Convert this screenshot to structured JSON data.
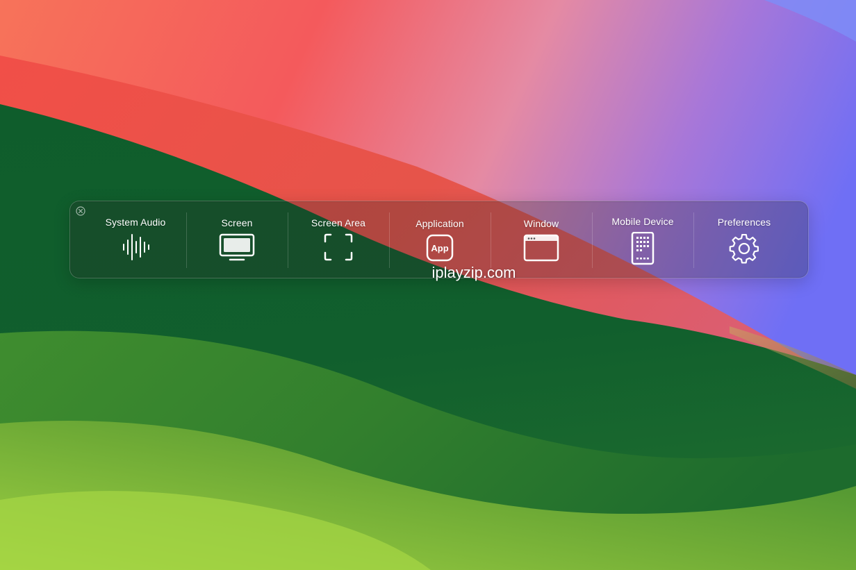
{
  "toolbar": {
    "items": [
      {
        "label": "System Audio",
        "icon": "waveform-icon"
      },
      {
        "label": "Screen",
        "icon": "display-icon"
      },
      {
        "label": "Screen Area",
        "icon": "selection-corners-icon"
      },
      {
        "label": "Application",
        "icon": "app-icon",
        "icon_text": "App"
      },
      {
        "label": "Window",
        "icon": "browser-window-icon"
      },
      {
        "label": "Mobile Device",
        "icon": "tablet-icon"
      },
      {
        "label": "Preferences",
        "icon": "gear-icon"
      }
    ],
    "close_icon": "close-circle-icon"
  },
  "watermark": {
    "text": "iplayzip.com"
  },
  "colors": {
    "icon_stroke": "#ffffff",
    "wallpaper_green_dark": "#0b5a2a",
    "wallpaper_green_light": "#8cc63f",
    "wallpaper_red": "#f2555a",
    "wallpaper_purple": "#7a6cf2"
  }
}
